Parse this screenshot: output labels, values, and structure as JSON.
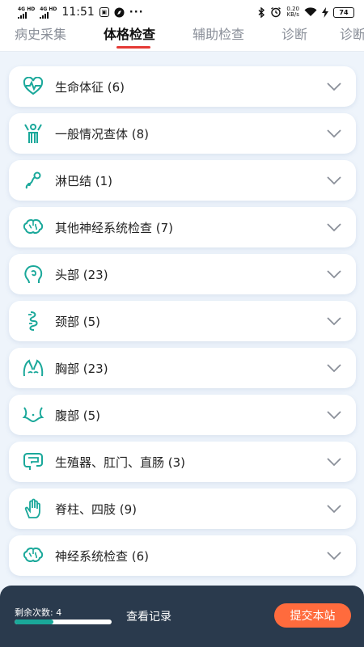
{
  "status_bar": {
    "signal1": "4G HD",
    "signal2": "4G HD",
    "time": "11:51",
    "more": "···",
    "net_speed_value": "0.20",
    "net_speed_unit": "KB/s",
    "battery": "74"
  },
  "tabs": [
    {
      "label": "病史采集",
      "active": false
    },
    {
      "label": "体格检查",
      "active": true
    },
    {
      "label": "辅助检查",
      "active": false
    },
    {
      "label": "诊断",
      "active": false
    },
    {
      "label": "诊断",
      "active": false
    }
  ],
  "accent_color": "#e53935",
  "icon_color": "#1aa89a",
  "sections": [
    {
      "label": "生命体征 (6)",
      "icon": "heartbeat-icon"
    },
    {
      "label": "一般情况查体 (8)",
      "icon": "person-general-icon"
    },
    {
      "label": "淋巴结 (1)",
      "icon": "lymph-node-icon"
    },
    {
      "label": "其他神经系统检查 (7)",
      "icon": "brain-icon"
    },
    {
      "label": "头部 (23)",
      "icon": "head-icon"
    },
    {
      "label": "颈部 (5)",
      "icon": "neck-icon"
    },
    {
      "label": "胸部 (23)",
      "icon": "chest-icon"
    },
    {
      "label": "腹部 (5)",
      "icon": "abdomen-icon"
    },
    {
      "label": "生殖器、肛门、直肠 (3)",
      "icon": "intestine-icon"
    },
    {
      "label": "脊柱、四肢 (9)",
      "icon": "hand-icon"
    },
    {
      "label": "神经系统检查 (6)",
      "icon": "brain-icon"
    }
  ],
  "bottom_bar": {
    "remaining_label": "剩余次数: 4",
    "remaining_progress": 0.4,
    "records_label": "查看记录",
    "submit_label": "提交本站",
    "submit_color": "#ff6b3d"
  }
}
